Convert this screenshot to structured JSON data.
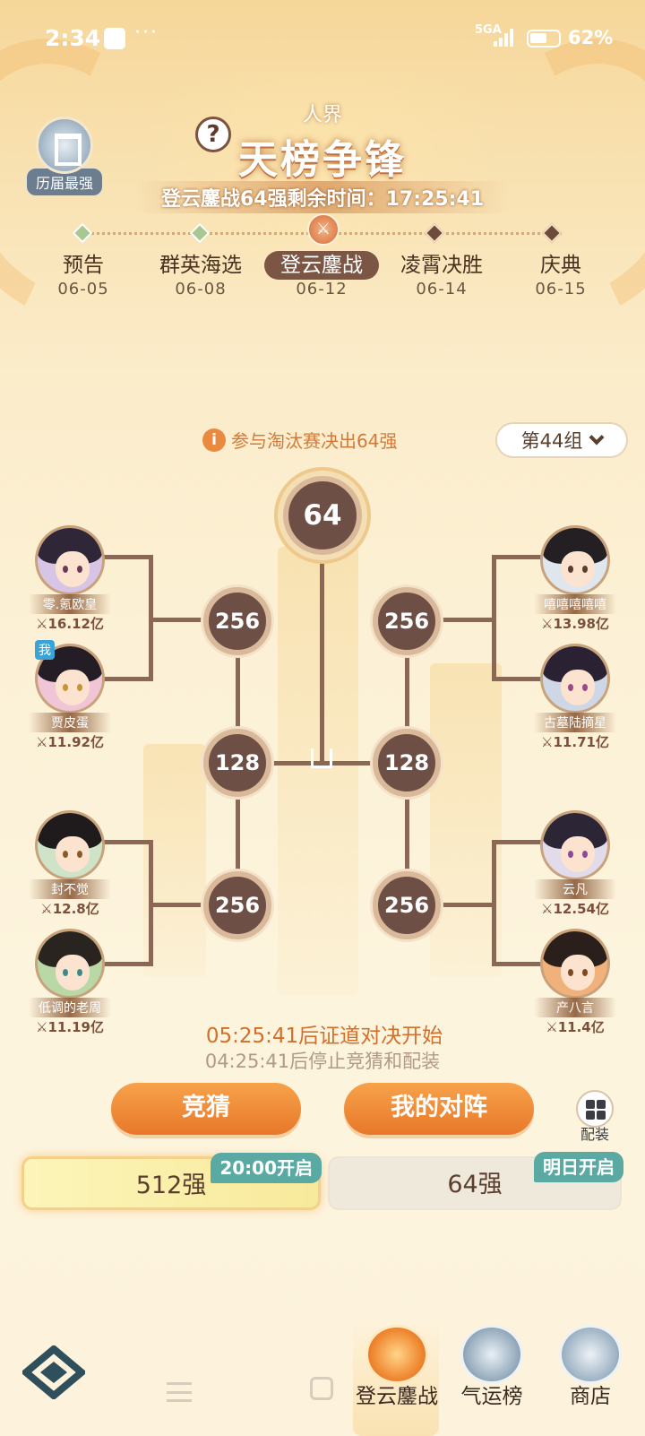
{
  "status_bar": {
    "time": "2:34",
    "dots": "···",
    "network": "5GA",
    "battery": "62%"
  },
  "header": {
    "history_label": "历届最强",
    "help": "?",
    "realm": "人界",
    "title": "天榜争锋",
    "countdown": "登云鏖战64强剩余时间：17:25:41"
  },
  "timeline": [
    {
      "name": "预告",
      "date": "06-05",
      "state": "done"
    },
    {
      "name": "群英海选",
      "date": "06-08",
      "state": "done"
    },
    {
      "name": "登云鏖战",
      "date": "06-12",
      "state": "active"
    },
    {
      "name": "凌霄决胜",
      "date": "06-14",
      "state": "upcoming"
    },
    {
      "name": "庆典",
      "date": "06-15",
      "state": "upcoming"
    }
  ],
  "info": {
    "icon": "i",
    "text": "参与淘汰赛决出64强"
  },
  "group_select": {
    "label": "第44组"
  },
  "bracket": {
    "final": "64",
    "r128": [
      "128",
      "128"
    ],
    "r256": [
      "256",
      "256",
      "256",
      "256"
    ]
  },
  "players": [
    {
      "name": "零.氪欧皇",
      "power": "⚔16.12亿",
      "me": false
    },
    {
      "name": "贾皮蛋",
      "power": "⚔11.92亿",
      "me": true,
      "me_label": "我"
    },
    {
      "name": "封不觉",
      "power": "⚔12.8亿",
      "me": false
    },
    {
      "name": "低调的老周",
      "power": "⚔11.19亿",
      "me": false
    },
    {
      "name": "嘻嘻嘻嘻嘻",
      "power": "⚔13.98亿",
      "me": false
    },
    {
      "name": "古墓陆摘星",
      "power": "⚔11.71亿",
      "me": false
    },
    {
      "name": "云凡",
      "power": "⚔12.54亿",
      "me": false
    },
    {
      "name": "产八言",
      "power": "⚔11.4亿",
      "me": false
    }
  ],
  "times": {
    "open": "05:25:41后证道对决开始",
    "stop": "04:25:41后停止竞猜和配装"
  },
  "buttons": {
    "guess": "竞猜",
    "my_match": "我的对阵",
    "equip": "配装"
  },
  "tabs": [
    {
      "label": "512强",
      "badge": "20:00开启",
      "selected": true
    },
    {
      "label": "64强",
      "badge": "明日开启",
      "selected": false
    }
  ],
  "bottom_nav": [
    {
      "label": "登云鏖战",
      "icon": "trophy-icon",
      "active": true
    },
    {
      "label": "气运榜",
      "icon": "fortune-icon",
      "active": false
    },
    {
      "label": "商店",
      "icon": "shop-icon",
      "active": false
    }
  ],
  "colors": {
    "accent": "#e8782a",
    "node": "#6e4f45",
    "badge": "#5aa9a2"
  }
}
